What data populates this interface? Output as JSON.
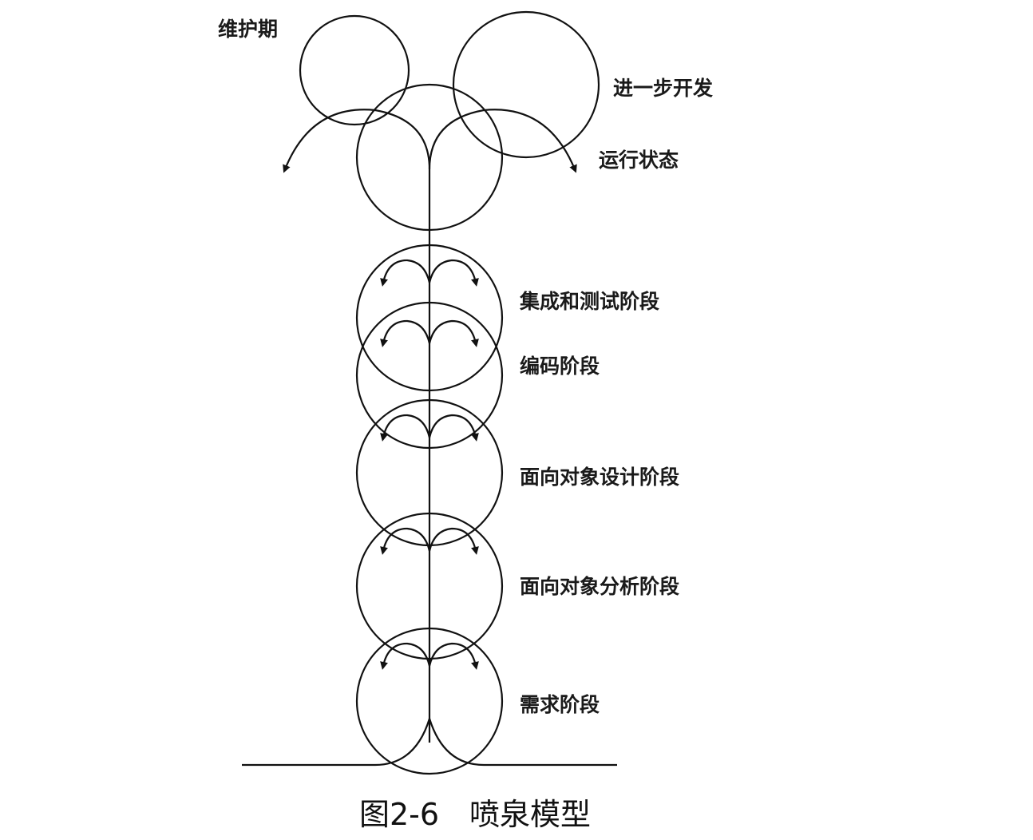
{
  "diagram": {
    "labels": {
      "maintenance": "维护期",
      "further_development": "进一步开发",
      "operation": "运行状态",
      "integration_testing": "集成和测试阶段",
      "coding": "编码阶段",
      "oo_design": "面向对象设计阶段",
      "oo_analysis": "面向对象分析阶段",
      "requirements": "需求阶段"
    },
    "caption": "图2-6　喷泉模型"
  }
}
